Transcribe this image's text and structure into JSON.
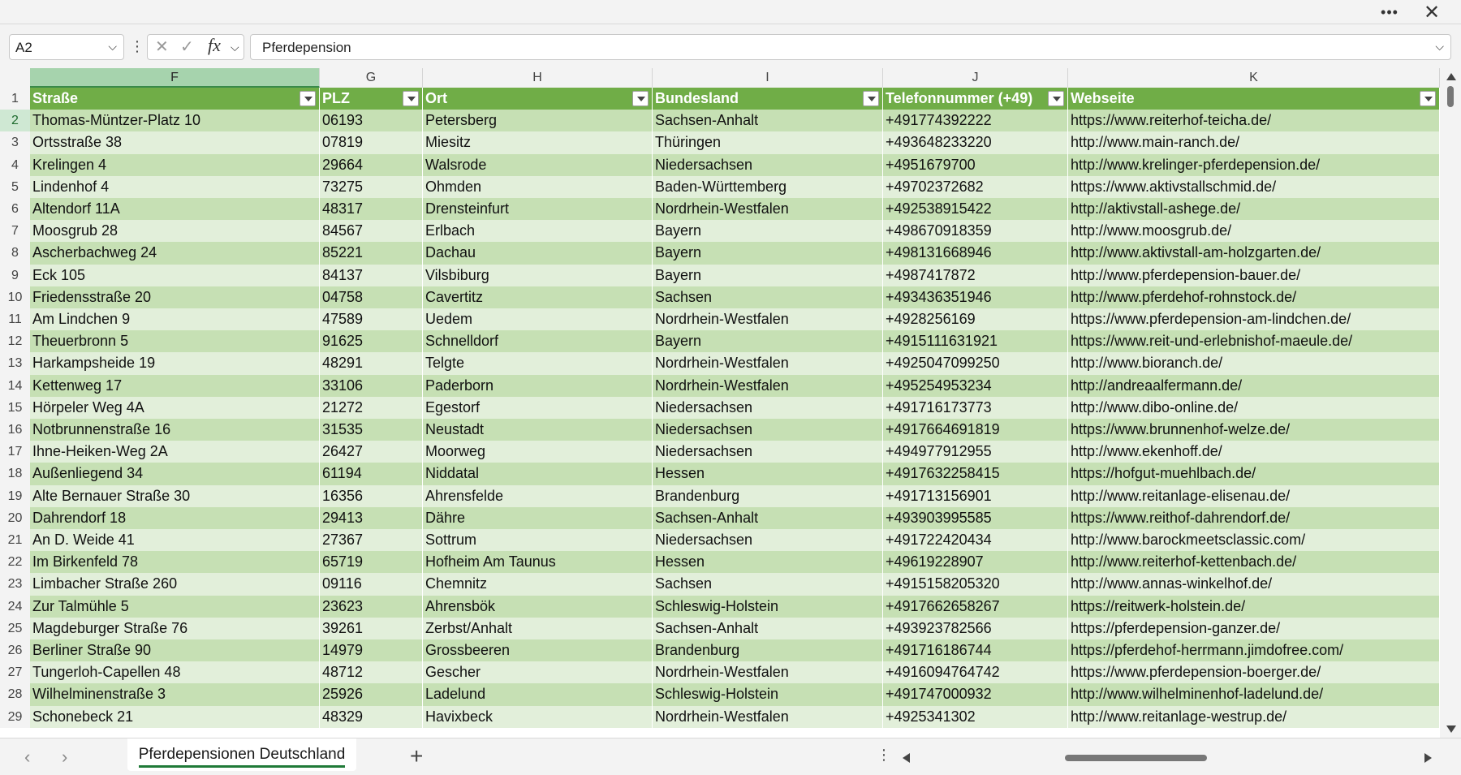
{
  "window": {
    "more_icon": "more-horizontal-icon",
    "close_icon": "close-icon"
  },
  "formula_bar": {
    "name_box": "A2",
    "content": "Pferdepension"
  },
  "columns": [
    {
      "letter": "F",
      "header": "Straße"
    },
    {
      "letter": "G",
      "header": "PLZ"
    },
    {
      "letter": "H",
      "header": "Ort"
    },
    {
      "letter": "I",
      "header": "Bundesland"
    },
    {
      "letter": "J",
      "header": "Telefonnummer (+49)"
    },
    {
      "letter": "K",
      "header": "Webseite"
    }
  ],
  "rows": [
    {
      "n": "2",
      "cells": [
        "Thomas-Müntzer-Platz 10",
        "06193",
        "Petersberg",
        "Sachsen-Anhalt",
        "+491774392222",
        "https://www.reiterhof-teicha.de/"
      ]
    },
    {
      "n": "3",
      "cells": [
        "Ortsstraße 38",
        "07819",
        "Miesitz",
        "Thüringen",
        "+493648233220",
        "http://www.main-ranch.de/"
      ]
    },
    {
      "n": "4",
      "cells": [
        "Krelingen 4",
        "29664",
        "Walsrode",
        "Niedersachsen",
        "+4951679700",
        "http://www.krelinger-pferdepension.de/"
      ]
    },
    {
      "n": "5",
      "cells": [
        "Lindenhof 4",
        "73275",
        "Ohmden",
        "Baden-Württemberg",
        "+49702372682",
        "https://www.aktivstallschmid.de/"
      ]
    },
    {
      "n": "6",
      "cells": [
        "Altendorf 11A",
        "48317",
        "Drensteinfurt",
        "Nordrhein-Westfalen",
        "+492538915422",
        "http://aktivstall-ashege.de/"
      ]
    },
    {
      "n": "7",
      "cells": [
        "Moosgrub 28",
        "84567",
        "Erlbach",
        "Bayern",
        "+498670918359",
        "http://www.moosgrub.de/"
      ]
    },
    {
      "n": "8",
      "cells": [
        "Ascherbachweg 24",
        "85221",
        "Dachau",
        "Bayern",
        "+498131668946",
        "http://www.aktivstall-am-holzgarten.de/"
      ]
    },
    {
      "n": "9",
      "cells": [
        "Eck 105",
        "84137",
        "Vilsbiburg",
        "Bayern",
        "+4987417872",
        "http://www.pferdepension-bauer.de/"
      ]
    },
    {
      "n": "10",
      "cells": [
        "Friedensstraße 20",
        "04758",
        "Cavertitz",
        "Sachsen",
        "+493436351946",
        "http://www.pferdehof-rohnstock.de/"
      ]
    },
    {
      "n": "11",
      "cells": [
        "Am Lindchen 9",
        "47589",
        "Uedem",
        "Nordrhein-Westfalen",
        "+4928256169",
        "https://www.pferdepension-am-lindchen.de/"
      ]
    },
    {
      "n": "12",
      "cells": [
        "Theuerbronn 5",
        "91625",
        "Schnelldorf",
        "Bayern",
        "+4915111631921",
        "https://www.reit-und-erlebnishof-maeule.de/"
      ]
    },
    {
      "n": "13",
      "cells": [
        "Harkampsheide 19",
        "48291",
        "Telgte",
        "Nordrhein-Westfalen",
        "+4925047099250",
        "http://www.bioranch.de/"
      ]
    },
    {
      "n": "14",
      "cells": [
        "Kettenweg 17",
        "33106",
        "Paderborn",
        "Nordrhein-Westfalen",
        "+495254953234",
        "http://andreaalfermann.de/"
      ]
    },
    {
      "n": "15",
      "cells": [
        "Hörpeler Weg 4A",
        "21272",
        "Egestorf",
        "Niedersachsen",
        "+491716173773",
        "http://www.dibo-online.de/"
      ]
    },
    {
      "n": "16",
      "cells": [
        "Notbrunnenstraße 16",
        "31535",
        "Neustadt",
        "Niedersachsen",
        "+4917664691819",
        "https://www.brunnenhof-welze.de/"
      ]
    },
    {
      "n": "17",
      "cells": [
        "Ihne-Heiken-Weg 2A",
        "26427",
        "Moorweg",
        "Niedersachsen",
        "+494977912955",
        "http://www.ekenhoff.de/"
      ]
    },
    {
      "n": "18",
      "cells": [
        "Außenliegend 34",
        "61194",
        "Niddatal",
        "Hessen",
        "+4917632258415",
        "https://hofgut-muehlbach.de/"
      ]
    },
    {
      "n": "19",
      "cells": [
        "Alte Bernauer Straße 30",
        "16356",
        "Ahrensfelde",
        "Brandenburg",
        "+491713156901",
        "http://www.reitanlage-elisenau.de/"
      ]
    },
    {
      "n": "20",
      "cells": [
        "Dahrendorf 18",
        "29413",
        "Dähre",
        "Sachsen-Anhalt",
        "+493903995585",
        "https://www.reithof-dahrendorf.de/"
      ]
    },
    {
      "n": "21",
      "cells": [
        "An D. Weide 41",
        "27367",
        "Sottrum",
        "Niedersachsen",
        "+491722420434",
        "http://www.barockmeetsclassic.com/"
      ]
    },
    {
      "n": "22",
      "cells": [
        "Im Birkenfeld 78",
        "65719",
        "Hofheim Am Taunus",
        "Hessen",
        "+49619228907",
        "http://www.reiterhof-kettenbach.de/"
      ]
    },
    {
      "n": "23",
      "cells": [
        "Limbacher Straße 260",
        "09116",
        "Chemnitz",
        "Sachsen",
        "+4915158205320",
        "http://www.annas-winkelhof.de/"
      ]
    },
    {
      "n": "24",
      "cells": [
        "Zur Talmühle 5",
        "23623",
        "Ahrensbök",
        "Schleswig-Holstein",
        "+4917662658267",
        "https://reitwerk-holstein.de/"
      ]
    },
    {
      "n": "25",
      "cells": [
        "Magdeburger Straße 76",
        "39261",
        "Zerbst/Anhalt",
        "Sachsen-Anhalt",
        "+493923782566",
        "https://pferdepension-ganzer.de/"
      ]
    },
    {
      "n": "26",
      "cells": [
        "Berliner Straße 90",
        "14979",
        "Grossbeeren",
        "Brandenburg",
        "+491716186744",
        "https://pferdehof-herrmann.jimdofree.com/"
      ]
    },
    {
      "n": "27",
      "cells": [
        "Tungerloh-Capellen 48",
        "48712",
        "Gescher",
        "Nordrhein-Westfalen",
        "+4916094764742",
        "https://www.pferdepension-boerger.de/"
      ]
    },
    {
      "n": "28",
      "cells": [
        "Wilhelminenstraße 3",
        "25926",
        "Ladelund",
        "Schleswig-Holstein",
        "+491747000932",
        "http://www.wilhelminenhof-ladelund.de/"
      ]
    },
    {
      "n": "29",
      "cells": [
        "Schonebeck 21",
        "48329",
        "Havixbeck",
        "Nordrhein-Westfalen",
        "+4925341302",
        "http://www.reitanlage-westrup.de/"
      ]
    }
  ],
  "sheet_tabs": [
    {
      "label": "Pferdepensionen Deutschland",
      "active": true
    }
  ],
  "colors": {
    "header_green": "#70ad47",
    "band_dark": "#c6e0b4",
    "band_light": "#e2efda",
    "accent": "#1f7a38"
  }
}
